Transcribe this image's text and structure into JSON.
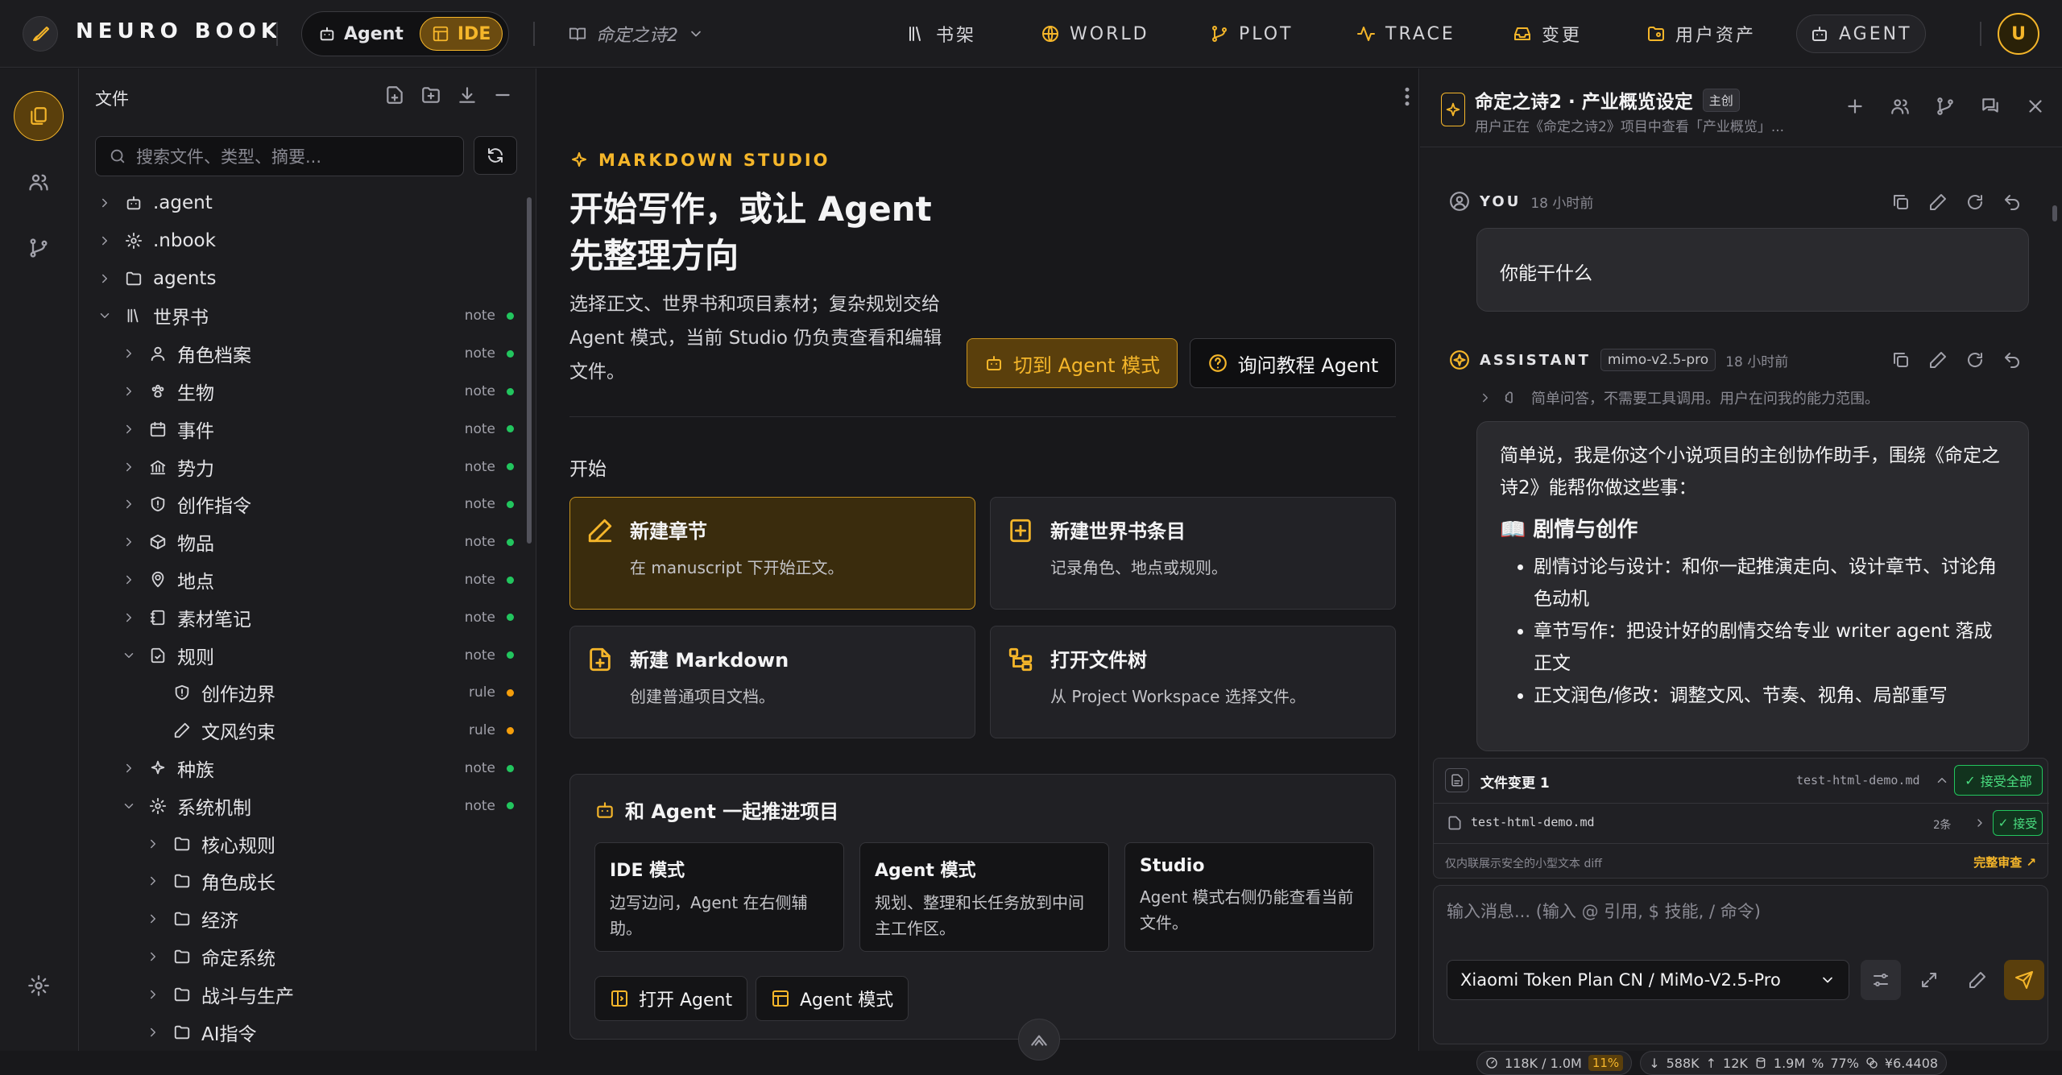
{
  "brand": "NEURO BOOK",
  "mode_toggle": {
    "agent": "Agent",
    "ide": "IDE"
  },
  "project": "命定之诗2",
  "nav": [
    {
      "label": "书架",
      "icon": "library-icon"
    },
    {
      "label": "WORLD",
      "icon": "globe-icon"
    },
    {
      "label": "PLOT",
      "icon": "branch-icon"
    },
    {
      "label": "TRACE",
      "icon": "pulse-icon"
    },
    {
      "label": "变更",
      "icon": "inbox-icon"
    },
    {
      "label": "用户资产",
      "icon": "folder-user-icon"
    },
    {
      "label": "AGENT",
      "icon": "bot-icon"
    }
  ],
  "user_avatar": "U",
  "files": {
    "title": "文件",
    "search_placeholder": "搜索文件、类型、摘要...",
    "tree": [
      {
        "label": ".agent",
        "icon": "bot-icon",
        "depth": 0,
        "expanded": false
      },
      {
        "label": ".nbook",
        "icon": "gear-icon",
        "depth": 0,
        "expanded": false
      },
      {
        "label": "agents",
        "icon": "folder-icon",
        "depth": 0,
        "expanded": false
      },
      {
        "label": "世界书",
        "icon": "library-icon",
        "depth": 0,
        "expanded": true,
        "tag": "note",
        "status": "green"
      },
      {
        "label": "角色档案",
        "icon": "user-icon",
        "depth": 1,
        "expanded": false,
        "tag": "note",
        "status": "green"
      },
      {
        "label": "生物",
        "icon": "paw-icon",
        "depth": 1,
        "expanded": false,
        "tag": "note",
        "status": "green"
      },
      {
        "label": "事件",
        "icon": "calendar-icon",
        "depth": 1,
        "expanded": false,
        "tag": "note",
        "status": "green"
      },
      {
        "label": "势力",
        "icon": "bank-icon",
        "depth": 1,
        "expanded": false,
        "tag": "note",
        "status": "green"
      },
      {
        "label": "创作指令",
        "icon": "shield-icon",
        "depth": 1,
        "expanded": false,
        "tag": "note",
        "status": "green"
      },
      {
        "label": "物品",
        "icon": "box-icon",
        "depth": 1,
        "expanded": false,
        "tag": "note",
        "status": "green"
      },
      {
        "label": "地点",
        "icon": "map-pin-icon",
        "depth": 1,
        "expanded": false,
        "tag": "note",
        "status": "green"
      },
      {
        "label": "素材笔记",
        "icon": "notebook-icon",
        "depth": 1,
        "expanded": false,
        "tag": "note",
        "status": "green"
      },
      {
        "label": "规则",
        "icon": "file-check-icon",
        "depth": 1,
        "expanded": true,
        "tag": "note",
        "status": "green"
      },
      {
        "label": "创作边界",
        "icon": "shield-icon",
        "depth": 2,
        "leaf": true,
        "tag": "rule",
        "status": "orange"
      },
      {
        "label": "文风约束",
        "icon": "pen-icon",
        "depth": 2,
        "leaf": true,
        "tag": "rule",
        "status": "orange"
      },
      {
        "label": "种族",
        "icon": "sparkle-icon",
        "depth": 1,
        "expanded": false,
        "tag": "note",
        "status": "green"
      },
      {
        "label": "系统机制",
        "icon": "gear-icon",
        "depth": 1,
        "expanded": true,
        "tag": "note",
        "status": "green"
      },
      {
        "label": "核心规则",
        "icon": "folder-icon",
        "depth": 2,
        "expanded": false
      },
      {
        "label": "角色成长",
        "icon": "folder-icon",
        "depth": 2,
        "expanded": false
      },
      {
        "label": "经济",
        "icon": "folder-icon",
        "depth": 2,
        "expanded": false
      },
      {
        "label": "命定系统",
        "icon": "folder-icon",
        "depth": 2,
        "expanded": false
      },
      {
        "label": "战斗与生产",
        "icon": "folder-icon",
        "depth": 2,
        "expanded": false
      },
      {
        "label": "AI指令",
        "icon": "folder-icon",
        "depth": 2,
        "expanded": false
      }
    ]
  },
  "studio": {
    "kicker": "MARKDOWN STUDIO",
    "title": "开始写作，或让 Agent 先整理方向",
    "lead": "选择正文、世界书和项目素材；复杂规划交给 Agent 模式，当前 Studio 仍负责查看和编辑文件。",
    "btn_switch": "切到 Agent 模式",
    "btn_ask": "询问教程 Agent",
    "start_label": "开始",
    "cards": [
      {
        "title": "新建章节",
        "desc": "在 manuscript 下开始正文。",
        "icon": "pen-icon"
      },
      {
        "title": "新建世界书条目",
        "desc": "记录角色、地点或规则。",
        "icon": "book-plus-icon"
      },
      {
        "title": "新建 Markdown",
        "desc": "创建普通项目文档。",
        "icon": "file-plus-icon"
      },
      {
        "title": "打开文件树",
        "desc": "从 Project Workspace 选择文件。",
        "icon": "tree-icon"
      }
    ],
    "agent_box": {
      "title": "和 Agent 一起推进项目",
      "modes": [
        {
          "title": "IDE 模式",
          "desc": "边写边问，Agent 在右侧辅助。"
        },
        {
          "title": "Agent 模式",
          "desc": "规划、整理和长任务放到中间主工作区。"
        },
        {
          "title": "Studio",
          "desc": "Agent 模式右侧仍能查看当前文件。"
        }
      ],
      "btn_open": "打开 Agent",
      "btn_mode": "Agent 模式"
    }
  },
  "chat": {
    "title": "命定之诗2 · 产业概览设定",
    "badge": "主创",
    "subtitle": "用户正在《命定之诗2》项目中查看「产业概览」...",
    "user_role": "YOU",
    "user_time": "18 小时前",
    "user_msg": "你能干什么",
    "assistant_role": "ASSISTANT",
    "model_tag": "mimo-v2.5-pro",
    "assistant_time": "18 小时前",
    "thinking": "简单问答，不需要工具调用。用户在问我的能力范围。",
    "intro": "简单说，我是你这个小说项目的主创协作助手，围绕《命定之诗2》能帮你做这些事：",
    "section": "📖 剧情与创作",
    "bullets": [
      "剧情讨论与设计：和你一起推演走向、设计章节、讨论角色动机",
      "章节写作：把设计好的剧情交给专业 writer agent 落成正文",
      "正文润色/修改：调整文风、节奏、视角、局部重写"
    ],
    "changes": {
      "title": "文件变更 1",
      "file": "test-html-demo.md",
      "accept_all": "接受全部",
      "row_file": "test-html-demo.md",
      "row_count": "2条",
      "accept": "接受",
      "note": "仅内联展示安全的小型文本 diff",
      "review": "完整审查 ↗"
    },
    "input_placeholder": "输入消息... (输入 @ 引用, $ 技能, / 命令)",
    "model_select": "Xiaomi Token Plan CN / MiMo-V2.5-Pro",
    "stats": {
      "context": "118K / 1.0M",
      "context_pct": "11%",
      "down": "588K",
      "up": "12K",
      "cache": "1.9M",
      "hit": "77%",
      "cost": "¥6.4408"
    }
  },
  "colors": {
    "accent": "#f5b62a",
    "green": "#22c55e",
    "orange": "#f59e0b",
    "bg": "#18181b"
  }
}
